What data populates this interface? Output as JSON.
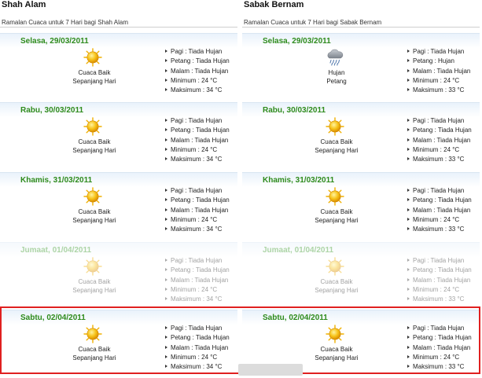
{
  "columns": [
    {
      "location": "Shah Alam",
      "subtitle": "Ramalan Cuaca untuk 7 Hari bagi Shah Alam",
      "days": [
        {
          "date": "Selasa, 29/03/2011",
          "icon": "sun-icon",
          "desc_line1": "Cuaca Baik",
          "desc_line2": "Sepanjang Hari",
          "pagi": "Pagi : Tiada Hujan",
          "petang": "Petang : Tiada Hujan",
          "malam": "Malam : Tiada Hujan",
          "minimum": "Minimum : 24 °C",
          "maksimum": "Maksimum : 34 °C"
        },
        {
          "date": "Rabu, 30/03/2011",
          "icon": "sun-icon",
          "desc_line1": "Cuaca Baik",
          "desc_line2": "Sepanjang Hari",
          "pagi": "Pagi : Tiada Hujan",
          "petang": "Petang : Tiada Hujan",
          "malam": "Malam : Tiada Hujan",
          "minimum": "Minimum : 24 °C",
          "maksimum": "Maksimum : 34 °C"
        },
        {
          "date": "Khamis, 31/03/2011",
          "icon": "sun-icon",
          "desc_line1": "Cuaca Baik",
          "desc_line2": "Sepanjang Hari",
          "pagi": "Pagi : Tiada Hujan",
          "petang": "Petang : Tiada Hujan",
          "malam": "Malam : Tiada Hujan",
          "minimum": "Minimum : 24 °C",
          "maksimum": "Maksimum : 34 °C"
        },
        {
          "date": "Jumaat, 01/04/2011",
          "icon": "sun-icon",
          "desc_line1": "Cuaca Baik",
          "desc_line2": "Sepanjang Hari",
          "pagi": "Pagi : Tiada Hujan",
          "petang": "Petang : Tiada Hujan",
          "malam": "Malam : Tiada Hujan",
          "minimum": "Minimum : 24 °C",
          "maksimum": "Maksimum : 34 °C"
        },
        {
          "date": "Sabtu, 02/04/2011",
          "icon": "sun-icon",
          "desc_line1": "Cuaca Baik",
          "desc_line2": "Sepanjang Hari",
          "pagi": "Pagi : Tiada Hujan",
          "petang": "Petang : Tiada Hujan",
          "malam": "Malam : Tiada Hujan",
          "minimum": "Minimum : 24 °C",
          "maksimum": "Maksimum : 34 °C"
        }
      ]
    },
    {
      "location": "Sabak Bernam",
      "subtitle": "Ramalan Cuaca untuk 7 Hari bagi Sabak Bernam",
      "days": [
        {
          "date": "Selasa, 29/03/2011",
          "icon": "rain-cloud-icon",
          "desc_line1": "Hujan",
          "desc_line2": "Petang",
          "pagi": "Pagi : Tiada Hujan",
          "petang": "Petang : Hujan",
          "malam": "Malam : Tiada Hujan",
          "minimum": "Minimum : 24 °C",
          "maksimum": "Maksimum : 33 °C"
        },
        {
          "date": "Rabu, 30/03/2011",
          "icon": "sun-icon",
          "desc_line1": "Cuaca Baik",
          "desc_line2": "Sepanjang Hari",
          "pagi": "Pagi : Tiada Hujan",
          "petang": "Petang : Tiada Hujan",
          "malam": "Malam : Tiada Hujan",
          "minimum": "Minimum : 24 °C",
          "maksimum": "Maksimum : 33 °C"
        },
        {
          "date": "Khamis, 31/03/2011",
          "icon": "sun-icon",
          "desc_line1": "Cuaca Baik",
          "desc_line2": "Sepanjang Hari",
          "pagi": "Pagi : Tiada Hujan",
          "petang": "Petang : Tiada Hujan",
          "malam": "Malam : Tiada Hujan",
          "minimum": "Minimum : 24 °C",
          "maksimum": "Maksimum : 33 °C"
        },
        {
          "date": "Jumaat, 01/04/2011",
          "icon": "sun-icon",
          "desc_line1": "Cuaca Baik",
          "desc_line2": "Sepanjang Hari",
          "pagi": "Pagi : Tiada Hujan",
          "petang": "Petang : Tiada Hujan",
          "malam": "Malam : Tiada Hujan",
          "minimum": "Minimum : 24 °C",
          "maksimum": "Maksimum : 33 °C"
        },
        {
          "date": "Sabtu, 02/04/2011",
          "icon": "sun-icon",
          "desc_line1": "Cuaca Baik",
          "desc_line2": "Sepanjang Hari",
          "pagi": "Pagi : Tiada Hujan",
          "petang": "Petang : Tiada Hujan",
          "malam": "Malam : Tiada Hujan",
          "minimum": "Minimum : 24 °C",
          "maksimum": "Maksimum : 33 °C"
        }
      ]
    }
  ],
  "colors": {
    "date_green": "#2e8b1c",
    "highlight_red": "#e02020",
    "sun": "#f2b200"
  }
}
